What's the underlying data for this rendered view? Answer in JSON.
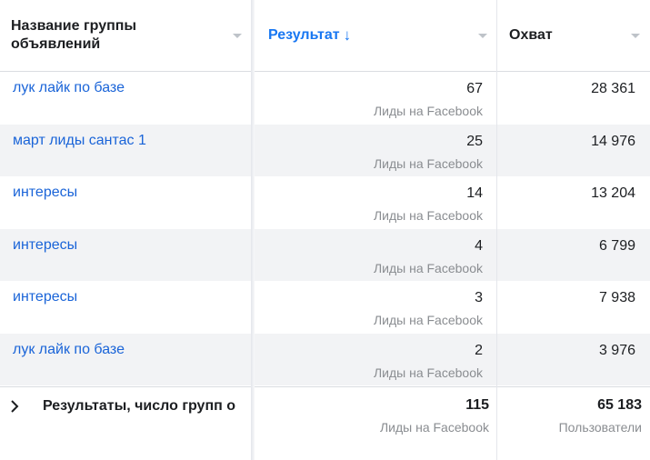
{
  "header": {
    "name_col": "Название группы объявлений",
    "result_col": "Результат",
    "result_sort_icon": "↓",
    "reach_col": "Охват"
  },
  "rows": [
    {
      "name": "лук лайк по базе",
      "result": "67",
      "result_sub": "Лиды на Facebook",
      "reach": "28 361"
    },
    {
      "name": "март лиды сантас 1",
      "result": "25",
      "result_sub": "Лиды на Facebook",
      "reach": "14 976"
    },
    {
      "name": "интересы",
      "result": "14",
      "result_sub": "Лиды на Facebook",
      "reach": "13 204"
    },
    {
      "name": "интересы",
      "result": "4",
      "result_sub": "Лиды на Facebook",
      "reach": "6 799"
    },
    {
      "name": "интересы",
      "result": "3",
      "result_sub": "Лиды на Facebook",
      "reach": "7 938"
    },
    {
      "name": "лук лайк по базе",
      "result": "2",
      "result_sub": "Лиды на Facebook",
      "reach": "3 976"
    }
  ],
  "footer": {
    "expand_icon": "chevron-right-icon",
    "label": "Результаты, число групп о",
    "total_result": "115",
    "total_result_sub": "Лиды на Facebook",
    "total_reach": "65 183",
    "total_reach_sub": "Пользователи"
  },
  "colors": {
    "link": "#1a64d8",
    "accent": "#1877f2",
    "muted": "#8a8d91",
    "row_alt": "#f2f3f5"
  }
}
